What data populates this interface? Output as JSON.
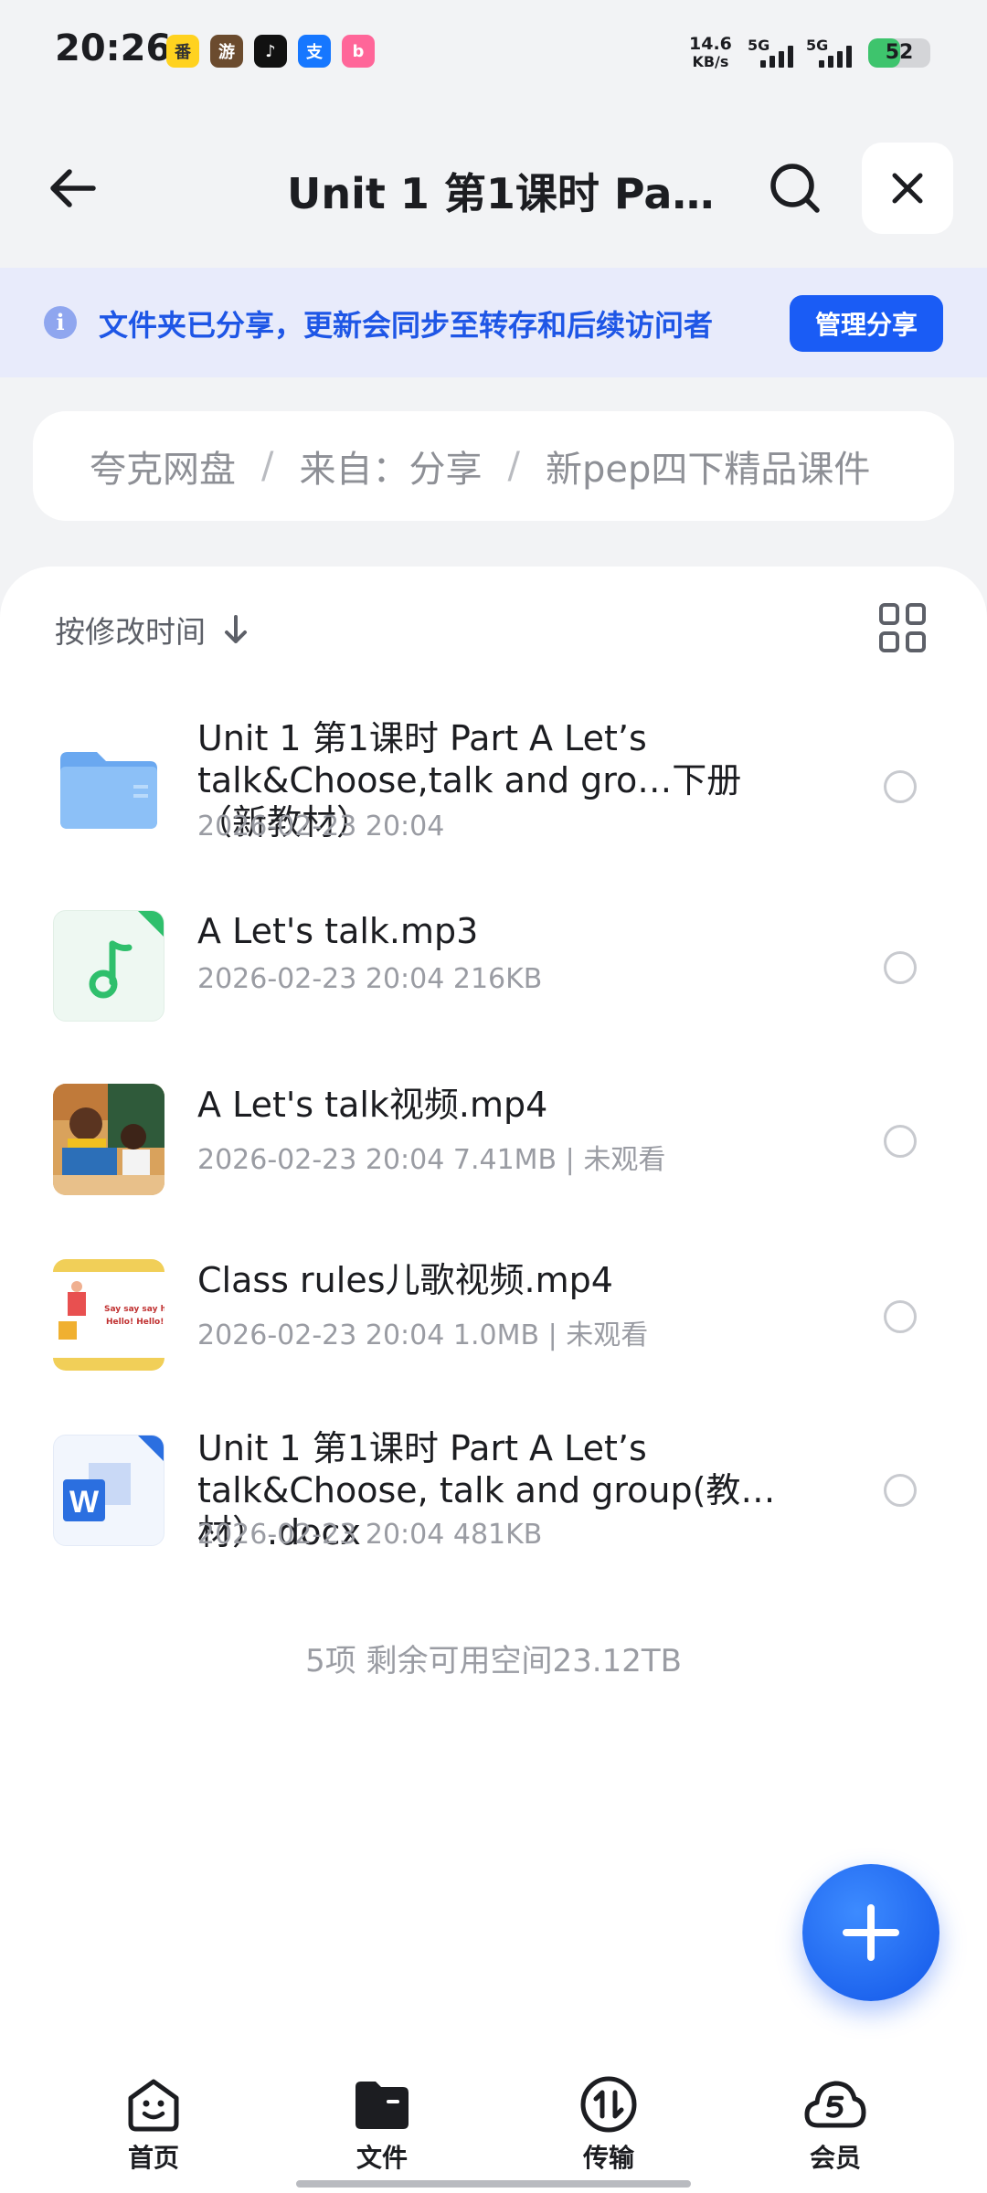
{
  "status_bar": {
    "time": "20:26",
    "net_speed_value": "14.6",
    "net_speed_unit": "KB/s",
    "signal1_label": "5G",
    "signal2_label": "5G",
    "battery_level": "52",
    "app_icons": [
      "fanqie-app-icon",
      "game-app-icon",
      "tiktok-app-icon",
      "alipay-app-icon",
      "bilibili-app-icon"
    ]
  },
  "header": {
    "title": "Unit 1 第1课时 Par…"
  },
  "share_banner": {
    "text": "文件夹已分享，更新会同步至转存和后续访问者",
    "button_label": "管理分享"
  },
  "breadcrumb": {
    "items": [
      "夸克网盘",
      "来自：分享",
      "新pep四下精品课件"
    ],
    "separator": "/"
  },
  "list": {
    "sort_label": "按修改时间",
    "files": [
      {
        "name": "Unit 1 第1课时 Part A Let’s talk&Choose,talk and gro…下册（新教材）",
        "meta": "2026-02-23 20:04",
        "type": "folder"
      },
      {
        "name": "A Let's talk.mp3",
        "meta": "2026-02-23 20:04  216KB",
        "type": "audio"
      },
      {
        "name": "A Let's talk视频.mp4",
        "meta": "2026-02-23 20:04  7.41MB | 未观看",
        "type": "video"
      },
      {
        "name": "Class rules儿歌视频.mp4",
        "meta": "2026-02-23 20:04  1.0MB | 未观看",
        "type": "video"
      },
      {
        "name": "Unit 1 第1课时 Part A Let’s talk&Choose, talk and group(教…材）.docx",
        "meta": "2026-02-23 20:04  481KB",
        "type": "word"
      }
    ],
    "video_thumb2_text1": "Say say say h",
    "video_thumb2_text2": "Hello! Hello!",
    "footer": "5项 剩余可用空间23.12TB"
  },
  "bottom_nav": {
    "items": [
      {
        "label": "首页",
        "icon": "home-face-icon"
      },
      {
        "label": "文件",
        "icon": "folder-icon"
      },
      {
        "label": "传输",
        "icon": "transfer-icon"
      },
      {
        "label": "会员",
        "icon": "cloud-member-icon"
      }
    ],
    "active_index": 1
  },
  "colors": {
    "accent": "#1a5cf5",
    "banner_bg": "#e8ebfb",
    "banner_text": "#1e56e6",
    "battery_fill": "#3ec46d"
  }
}
